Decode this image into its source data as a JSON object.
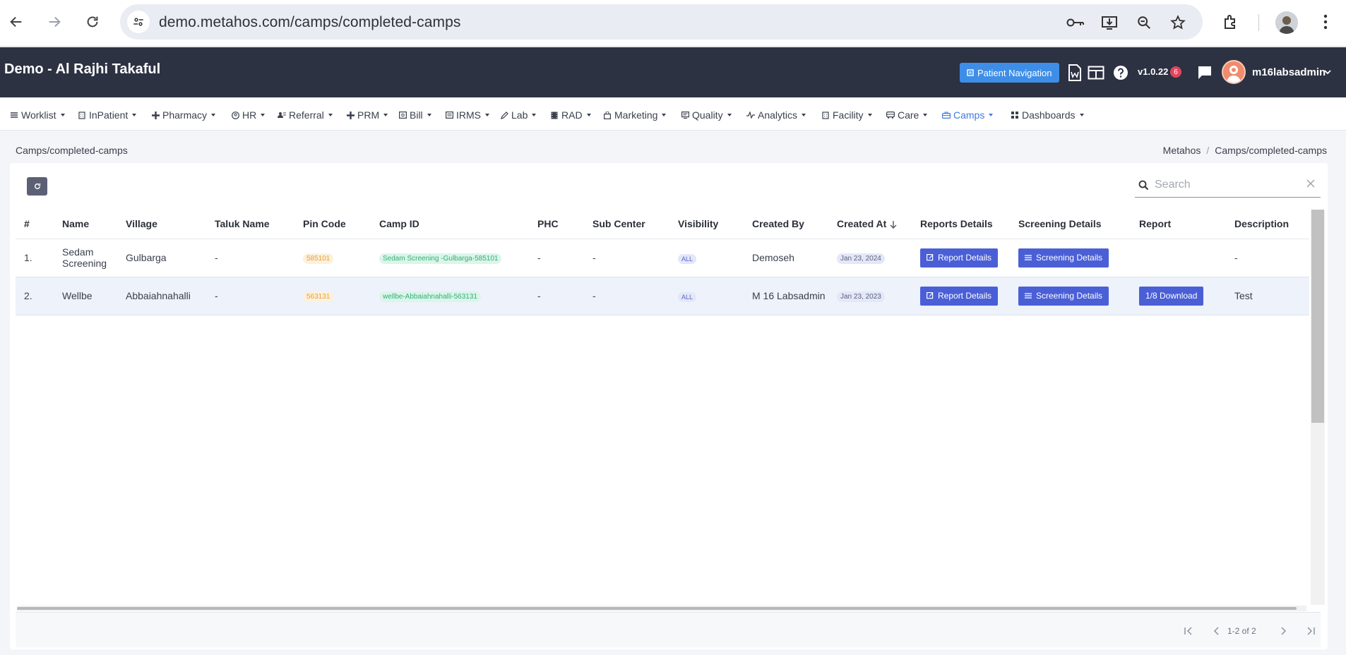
{
  "browser": {
    "url": "demo.metahos.com/camps/completed-camps"
  },
  "header": {
    "title": "Demo - Al Rajhi Takaful",
    "patient_navigation_label": "Patient Navigation",
    "version": "v1.0.22",
    "version_badge": "6",
    "username": "m16labsadmin"
  },
  "menu": [
    {
      "label": "Worklist",
      "icon": "list-icon"
    },
    {
      "label": "InPatient",
      "icon": "building-icon"
    },
    {
      "label": "Pharmacy",
      "icon": "plus-icon"
    },
    {
      "label": "HR",
      "icon": "user-circle-icon"
    },
    {
      "label": "Referral",
      "icon": "users-icon"
    },
    {
      "label": "PRM",
      "icon": "plus-icon"
    },
    {
      "label": "Bill",
      "icon": "bill-icon"
    },
    {
      "label": "IRMS",
      "icon": "card-icon"
    },
    {
      "label": "Lab",
      "icon": "pen-icon"
    },
    {
      "label": "RAD",
      "icon": "film-icon"
    },
    {
      "label": "Marketing",
      "icon": "bag-icon"
    },
    {
      "label": "Quality",
      "icon": "monitor-icon"
    },
    {
      "label": "Analytics",
      "icon": "pulse-icon"
    },
    {
      "label": "Facility",
      "icon": "building-icon"
    },
    {
      "label": "Care",
      "icon": "bus-icon"
    },
    {
      "label": "Camps",
      "icon": "briefcase-icon",
      "active": true
    },
    {
      "label": "Dashboards",
      "icon": "grid-icon"
    }
  ],
  "breadcrumb": {
    "page": "Camps/completed-camps",
    "root": "Metahos",
    "current": "Camps/completed-camps"
  },
  "search": {
    "placeholder": "Search"
  },
  "table": {
    "columns": [
      "#",
      "Name",
      "Village",
      "Taluk Name",
      "Pin Code",
      "Camp ID",
      "PHC",
      "Sub Center",
      "Visibility",
      "Created By",
      "Created At",
      "Reports Details",
      "Screening Details",
      "Report",
      "Description"
    ],
    "rows": [
      {
        "num": "1.",
        "name": "Sedam Screening",
        "village": "Gulbarga",
        "taluk": "-",
        "pin": "585101",
        "camp_id": "Sedam Screening -Gulbarga-585101",
        "phc": "-",
        "sub_center": "-",
        "visibility": "ALL",
        "created_by": "Demoseh",
        "created_at": "Jan 23, 2024",
        "report_details": "Report Details",
        "screening_details": "Screening Details",
        "report": "",
        "description": "-"
      },
      {
        "num": "2.",
        "name": "Wellbe",
        "village": "Abbaiahnahalli",
        "taluk": "-",
        "pin": "563131",
        "camp_id": "wellbe-Abbaiahnahalli-563131",
        "phc": "-",
        "sub_center": "-",
        "visibility": "ALL",
        "created_by": "M 16 Labsadmin",
        "created_at": "Jan 23, 2023",
        "report_details": "Report Details",
        "screening_details": "Screening Details",
        "report": "1/8 Download",
        "description": "Test"
      }
    ]
  },
  "pagination": {
    "text": "1-2 of 2"
  },
  "colors": {
    "header_bg": "#2c3242",
    "accent": "#4a5fd6",
    "patient_nav": "#3e8ee8",
    "active_menu": "#3e7be0"
  }
}
